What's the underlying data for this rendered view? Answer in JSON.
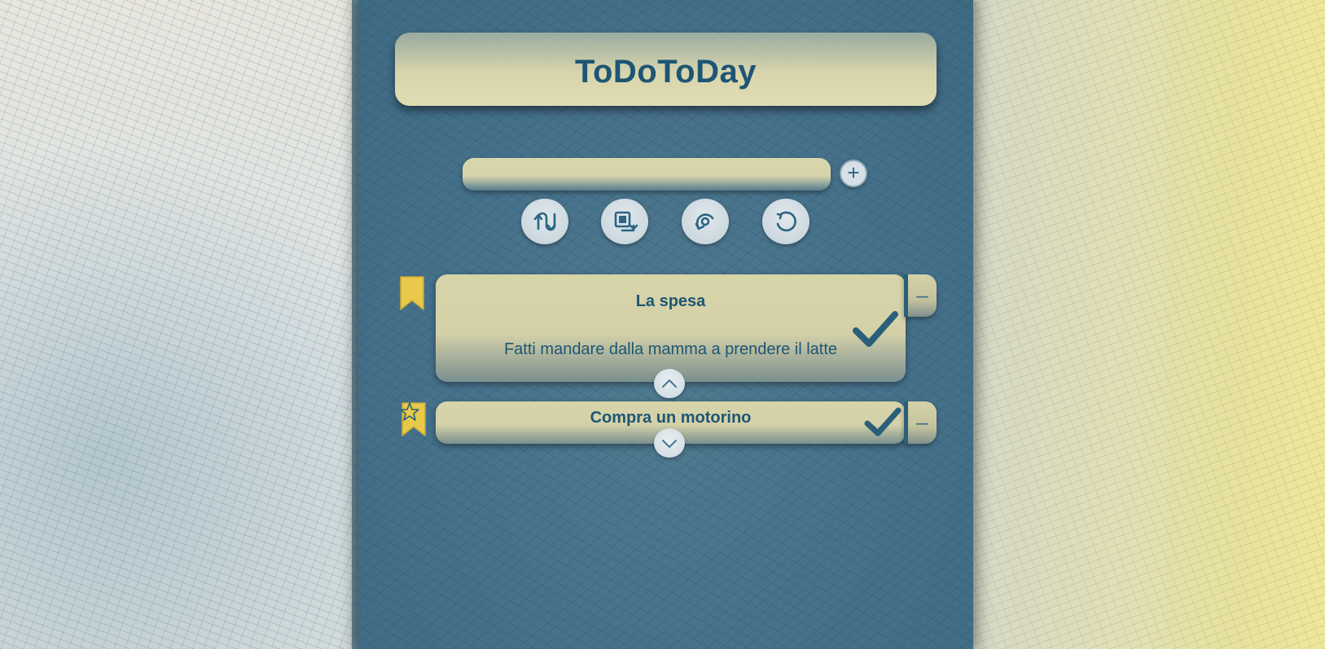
{
  "app": {
    "title": "ToDoToDay"
  },
  "new_task": {
    "value": "",
    "placeholder": "",
    "add_icon": "plus-icon",
    "add_label": "+"
  },
  "toolbar": {
    "buttons": [
      {
        "icon": "sort-swap-icon"
      },
      {
        "icon": "move-export-icon"
      },
      {
        "icon": "reload-arrow-icon"
      },
      {
        "icon": "reset-circle-icon"
      }
    ]
  },
  "tasks": [
    {
      "title": "La spesa",
      "description": "Fatti mandare dalla mamma a prendere il latte",
      "bookmark_icon": "bookmark-icon",
      "check_icon": "checkmark-icon",
      "remove_label": "–",
      "move_icon": "chevron-up-icon"
    },
    {
      "title": "Compra un motorino",
      "description": "",
      "bookmark_icon": "bookmark-star-icon",
      "check_icon": "checkmark-icon",
      "remove_label": "–",
      "move_icon": "chevron-down-icon"
    }
  ],
  "colors": {
    "accent_text": "#1d5674",
    "card": "#d7d4aa",
    "panel": "#4a7589",
    "bookmark": "#e8c94a"
  }
}
